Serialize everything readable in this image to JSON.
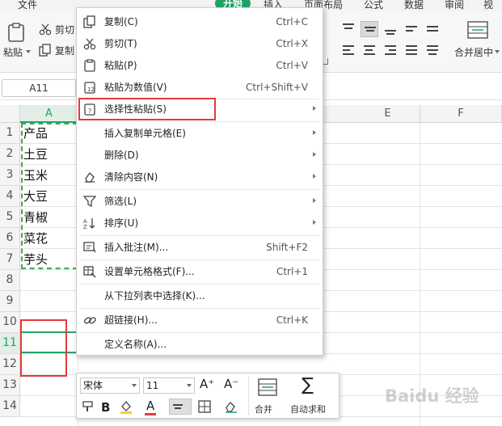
{
  "ribbon": {
    "tabs": [
      "文件",
      "开始",
      "插入",
      "页面布局",
      "公式",
      "数据",
      "审阅",
      "视图"
    ],
    "active_tab": "开始",
    "paste_label": "粘贴",
    "cut_label": "剪切",
    "copy_label": "复制",
    "merge_label": "合并居中"
  },
  "formula_bar": {
    "name_box": "A11"
  },
  "columns": [
    "A",
    "E",
    "F"
  ],
  "rows": [
    "1",
    "2",
    "3",
    "4",
    "5",
    "6",
    "7",
    "8",
    "9",
    "10",
    "11",
    "12",
    "13",
    "14"
  ],
  "cells": [
    "产品",
    "土豆",
    "玉米",
    "大豆",
    "青椒",
    "菜花",
    "芋头"
  ],
  "context_menu": {
    "items": [
      {
        "label": "复制(C)",
        "shortcut": "Ctrl+C",
        "icon": "copy-icon"
      },
      {
        "label": "剪切(T)",
        "shortcut": "Ctrl+X",
        "icon": "scissors-icon"
      },
      {
        "label": "粘贴(P)",
        "shortcut": "Ctrl+V",
        "icon": "paste-icon"
      },
      {
        "label": "粘贴为数值(V)",
        "shortcut": "Ctrl+Shift+V",
        "icon": "paste-values-icon"
      },
      {
        "label": "选择性粘贴(S)",
        "shortcut": "",
        "icon": "paste-special-icon",
        "submenu": true
      },
      {
        "label": "插入复制单元格(E)",
        "shortcut": "",
        "icon": "",
        "submenu": true
      },
      {
        "label": "删除(D)",
        "shortcut": "",
        "icon": "",
        "submenu": true
      },
      {
        "label": "清除内容(N)",
        "shortcut": "",
        "icon": "eraser-icon",
        "submenu": true
      },
      {
        "label": "筛选(L)",
        "shortcut": "",
        "icon": "filter-icon",
        "submenu": true
      },
      {
        "label": "排序(U)",
        "shortcut": "",
        "icon": "sort-icon",
        "submenu": true
      },
      {
        "label": "插入批注(M)...",
        "shortcut": "Shift+F2",
        "icon": "comment-icon"
      },
      {
        "label": "设置单元格格式(F)...",
        "shortcut": "Ctrl+1",
        "icon": "format-cells-icon"
      },
      {
        "label": "从下拉列表中选择(K)...",
        "shortcut": "",
        "icon": ""
      },
      {
        "label": "超链接(H)...",
        "shortcut": "Ctrl+K",
        "icon": "link-icon"
      },
      {
        "label": "定义名称(A)...",
        "shortcut": "",
        "icon": ""
      }
    ]
  },
  "mini_toolbar": {
    "font_name": "宋体",
    "font_size": "11",
    "bold": "B",
    "font_color_glyph": "A",
    "merge_label": "合并",
    "autosum_label": "自动求和",
    "sigma": "∑",
    "grow_font": "A⁺",
    "shrink_font": "A⁻"
  },
  "watermark": "Baidu 经验",
  "colors": {
    "accent": "#21a366",
    "highlight": "#e33b3b",
    "marquee": "#3fa84f"
  }
}
